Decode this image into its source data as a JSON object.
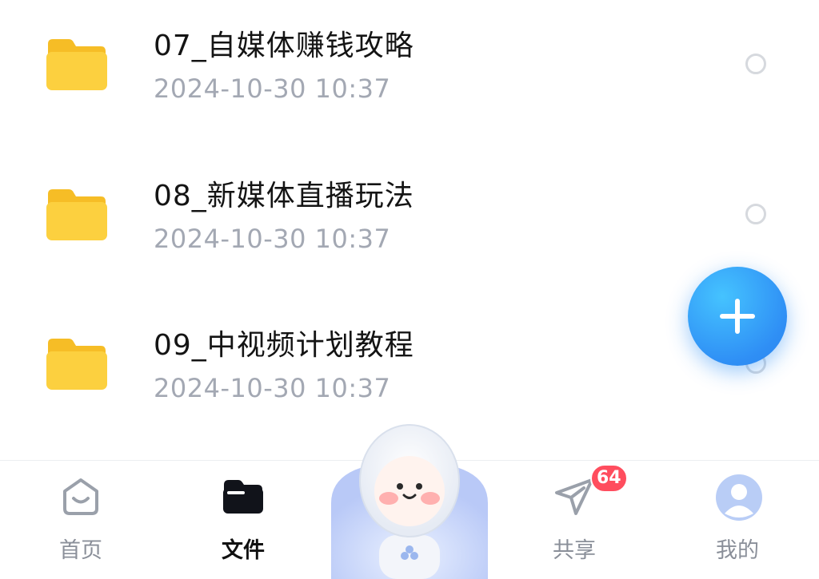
{
  "files": [
    {
      "name": "07_自媒体赚钱攻略",
      "date": "2024-10-30  10:37"
    },
    {
      "name": "08_新媒体直播玩法",
      "date": "2024-10-30  10:37"
    },
    {
      "name": "09_中视频计划教程",
      "date": "2024-10-30  10:37"
    }
  ],
  "fab": {
    "icon": "plus-icon"
  },
  "tabs": {
    "home": {
      "label": "首页",
      "icon": "home-icon"
    },
    "files": {
      "label": "文件",
      "icon": "folder-icon",
      "active": true
    },
    "share": {
      "label": "共享",
      "icon": "paper-plane-icon",
      "badge": "64"
    },
    "mine": {
      "label": "我的",
      "icon": "avatar-icon"
    }
  },
  "colors": {
    "accent": "#2f8ff5",
    "badge": "#ff4d5e",
    "folder": "#fbcf3a",
    "date_text": "#a3a8b3"
  }
}
